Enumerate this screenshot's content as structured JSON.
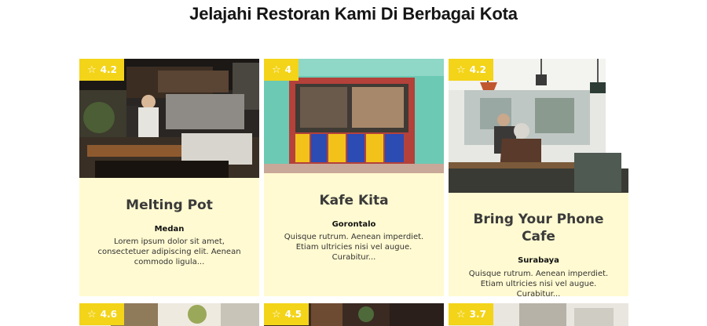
{
  "page": {
    "title": "Jelajahi Restoran Kami Di Berbagai Kota"
  },
  "colors": {
    "card_bg": "#fffad1",
    "badge_bg": "#f3d418",
    "badge_text": "#ffffff"
  },
  "restaurants": [
    {
      "rating": "4.2",
      "name": "Melting Pot",
      "city": "Medan",
      "desc": "Lorem ipsum dolor sit amet, consectetuer adipiscing elit. Aenean commodo ligula..."
    },
    {
      "rating": "4",
      "name": "Kafe Kita",
      "city": "Gorontalo",
      "desc": "Quisque rutrum. Aenean imperdiet. Etiam ultricies nisi vel augue. Curabitur..."
    },
    {
      "rating": "4.2",
      "name": "Bring Your Phone Cafe",
      "city": "Surabaya",
      "desc": "Quisque rutrum. Aenean imperdiet. Etiam ultricies nisi vel augue. Curabitur..."
    },
    {
      "rating": "4.6"
    },
    {
      "rating": "4.5"
    },
    {
      "rating": "3.7"
    }
  ],
  "icons": {
    "rating": "star-outline-icon"
  }
}
